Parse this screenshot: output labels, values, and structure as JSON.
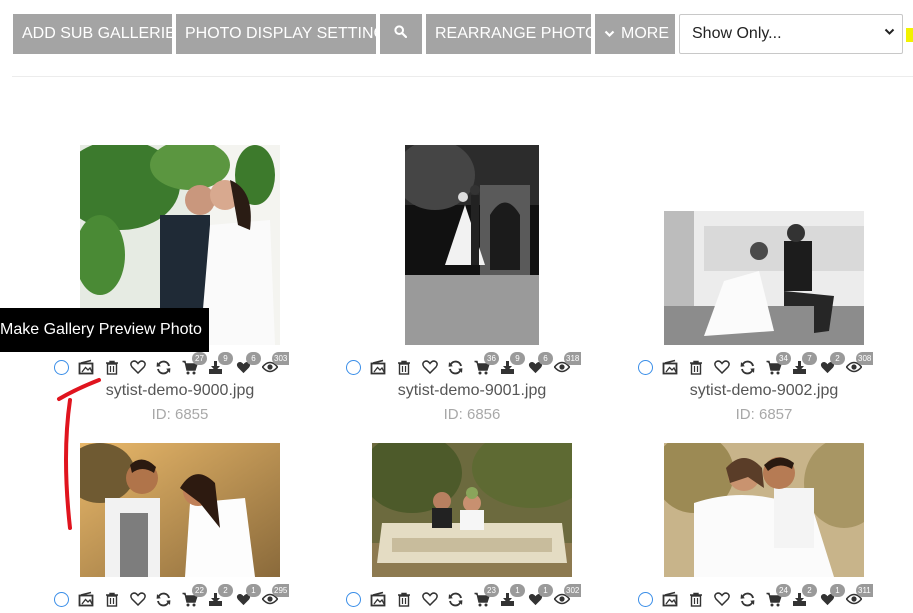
{
  "toolbar": {
    "add_sub_galleries": "ADD SUB GALLERIES",
    "photo_display_settings": "PHOTO DISPLAY SETTINGS",
    "rearrange_photos": "REARRANGE PHOTOS",
    "more": "MORE",
    "show_only": "Show Only...",
    "search_icon": "search-icon"
  },
  "tooltip": {
    "text": "Make Gallery Preview Photo"
  },
  "photos": [
    {
      "filename": "sytist-demo-9000.jpg",
      "id": "ID: 6855",
      "cart": "27",
      "downloads": "9",
      "favorites": "6",
      "views": "303"
    },
    {
      "filename": "sytist-demo-9001.jpg",
      "id": "ID: 6856",
      "cart": "36",
      "downloads": "9",
      "favorites": "6",
      "views": "318"
    },
    {
      "filename": "sytist-demo-9002.jpg",
      "id": "ID: 6857",
      "cart": "34",
      "downloads": "7",
      "favorites": "2",
      "views": "308"
    },
    {
      "cart": "22",
      "downloads": "2",
      "favorites": "1",
      "views": "295"
    },
    {
      "cart": "23",
      "downloads": "1",
      "favorites": "1",
      "views": "302"
    },
    {
      "cart": "24",
      "downloads": "2",
      "favorites": "1",
      "views": "311"
    }
  ],
  "colors": {
    "button_bg": "#a4a4a4",
    "checkbox": "#3a8ee8",
    "annotation_arrow": "#e0141e",
    "highlight": "#f2f200"
  }
}
